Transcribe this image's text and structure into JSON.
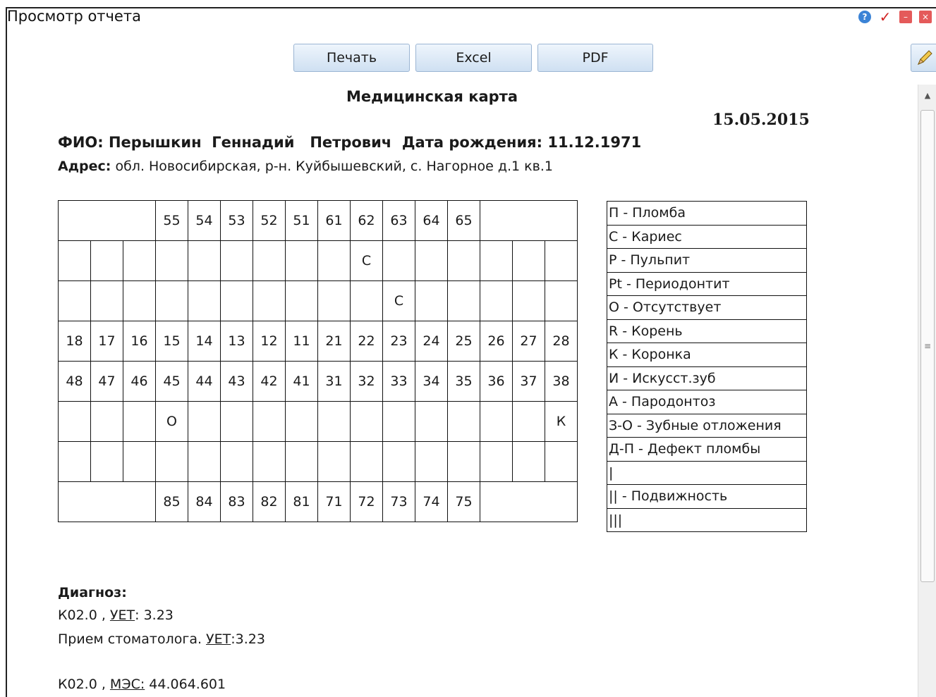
{
  "window": {
    "title": "Просмотр отчета"
  },
  "toolbar": {
    "print_label": "Печать",
    "excel_label": "Excel",
    "pdf_label": "PDF"
  },
  "report": {
    "title": "Медицинская карта",
    "date": "15.05.2015",
    "fio_label": "ФИО:",
    "fio_value": "Перышкин  Геннадий   Петрович",
    "dob_label": "Дата рождения:",
    "dob_value": "11.12.1971",
    "address_label": "Адрес:",
    "address_value": "обл. Новосибирская, р-н. Куйбышевский, с. Нагорное д.1 кв.1"
  },
  "dental_chart": {
    "upper_primary": [
      "55",
      "54",
      "53",
      "52",
      "51",
      "61",
      "62",
      "63",
      "64",
      "65"
    ],
    "upper_marks_row1": [
      "",
      "",
      "",
      "",
      "",
      "",
      "",
      "",
      "",
      "C",
      "",
      "",
      "",
      "",
      "",
      ""
    ],
    "upper_marks_row2": [
      "",
      "",
      "",
      "",
      "",
      "",
      "",
      "",
      "",
      "",
      "C",
      "",
      "",
      "",
      "",
      ""
    ],
    "upper_permanent": [
      "18",
      "17",
      "16",
      "15",
      "14",
      "13",
      "12",
      "11",
      "21",
      "22",
      "23",
      "24",
      "25",
      "26",
      "27",
      "28"
    ],
    "lower_permanent": [
      "48",
      "47",
      "46",
      "45",
      "44",
      "43",
      "42",
      "41",
      "31",
      "32",
      "33",
      "34",
      "35",
      "36",
      "37",
      "38"
    ],
    "lower_marks_row1": [
      "",
      "",
      "",
      "О",
      "",
      "",
      "",
      "",
      "",
      "",
      "",
      "",
      "",
      "",
      "",
      "К"
    ],
    "lower_marks_row2": [
      "",
      "",
      "",
      "",
      "",
      "",
      "",
      "",
      "",
      "",
      "",
      "",
      "",
      "",
      "",
      ""
    ],
    "lower_primary": [
      "85",
      "84",
      "83",
      "82",
      "81",
      "71",
      "72",
      "73",
      "74",
      "75"
    ]
  },
  "legend": [
    "П - Пломба",
    "С - Кариес",
    "Р - Пульпит",
    "Pt - Периодонтит",
    "О - Отсутствует",
    "R - Корень",
    "К - Коронка",
    "И - Искусст.зуб",
    "А - Пародонтоз",
    "З-О - Зубные отложения",
    "Д-П - Дефект пломбы",
    "|",
    "|| - Подвижность",
    "|||"
  ],
  "diagnosis": {
    "heading": "Диагноз:",
    "line1_code": "К02.0 ,",
    "line1_link": "УЕТ",
    "line1_value": ": 3.23",
    "line2_text": "Прием стоматолога.",
    "line2_link": "УЕТ",
    "line2_value": ":3.23",
    "line3_code": "К02.0 ,",
    "line3_link": "МЭС:",
    "line3_value": "44.064.601"
  },
  "icons": {
    "help": "help-icon",
    "apply": "check-icon",
    "minimize": "minimize-icon",
    "close": "close-icon",
    "edit": "pencil-icon"
  }
}
